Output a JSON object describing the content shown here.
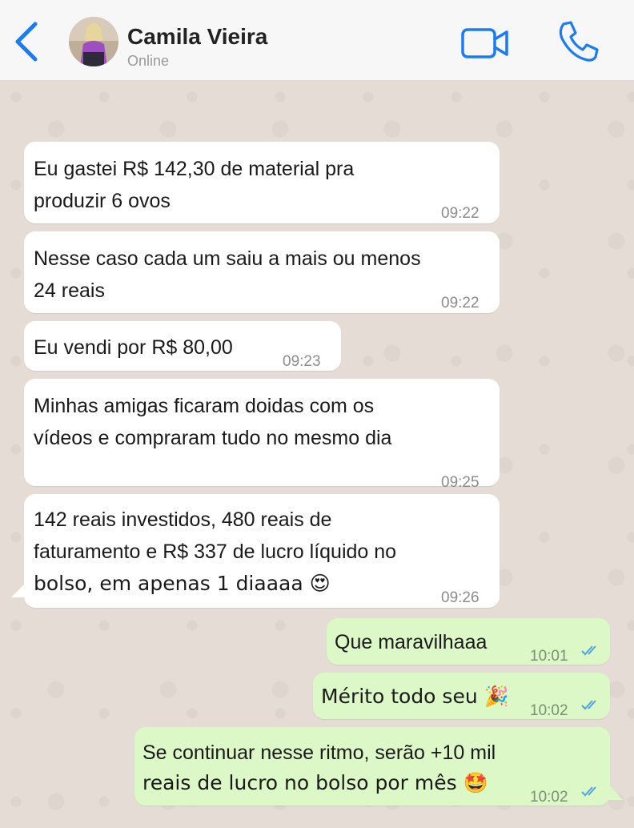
{
  "header": {
    "contact_name": "Camila Vieira",
    "status": "Online",
    "icons": [
      "chevron-left-icon",
      "video-camera-icon",
      "phone-icon"
    ],
    "accent_color": "#1a7bf2"
  },
  "messages": [
    {
      "direction": "in",
      "text_lines": [
        "Eu gastei R$ 142,30 de material pra",
        "produzir 6 ovos"
      ],
      "time": "09:22"
    },
    {
      "direction": "in",
      "text_lines": [
        "Nesse caso cada um saiu a mais ou menos",
        "24 reais"
      ],
      "time": "09:22"
    },
    {
      "direction": "in",
      "text_lines": [
        "Eu vendi por R$ 80,00"
      ],
      "time": "09:23"
    },
    {
      "direction": "in",
      "text_lines": [
        "Minhas amigas ficaram doidas com os",
        "vídeos e compraram tudo no mesmo dia"
      ],
      "time": "09:25"
    },
    {
      "direction": "in",
      "text_lines": [
        "142 reais investidos, 480 reais de",
        "faturamento e R$ 337 de lucro líquido no",
        "bolso, em apenas 1 diaaaa 😍"
      ],
      "time": "09:26"
    },
    {
      "direction": "out",
      "text_lines": [
        "Que maravilhaaa"
      ],
      "time": "10:01",
      "status": "read"
    },
    {
      "direction": "out",
      "text_lines": [
        "Mérito todo seu 🎉"
      ],
      "time": "10:02",
      "status": "read"
    },
    {
      "direction": "out",
      "text_lines": [
        "Se continuar nesse ritmo, serão +10 mil",
        "reais de lucro no bolso por mês 🤩"
      ],
      "time": "10:02",
      "status": "read"
    }
  ],
  "colors": {
    "incoming_bubble": "#ffffff",
    "outgoing_bubble": "#dcf8c6",
    "chat_background": "#e5ddd5",
    "read_ticks": "#4fa3e8"
  }
}
